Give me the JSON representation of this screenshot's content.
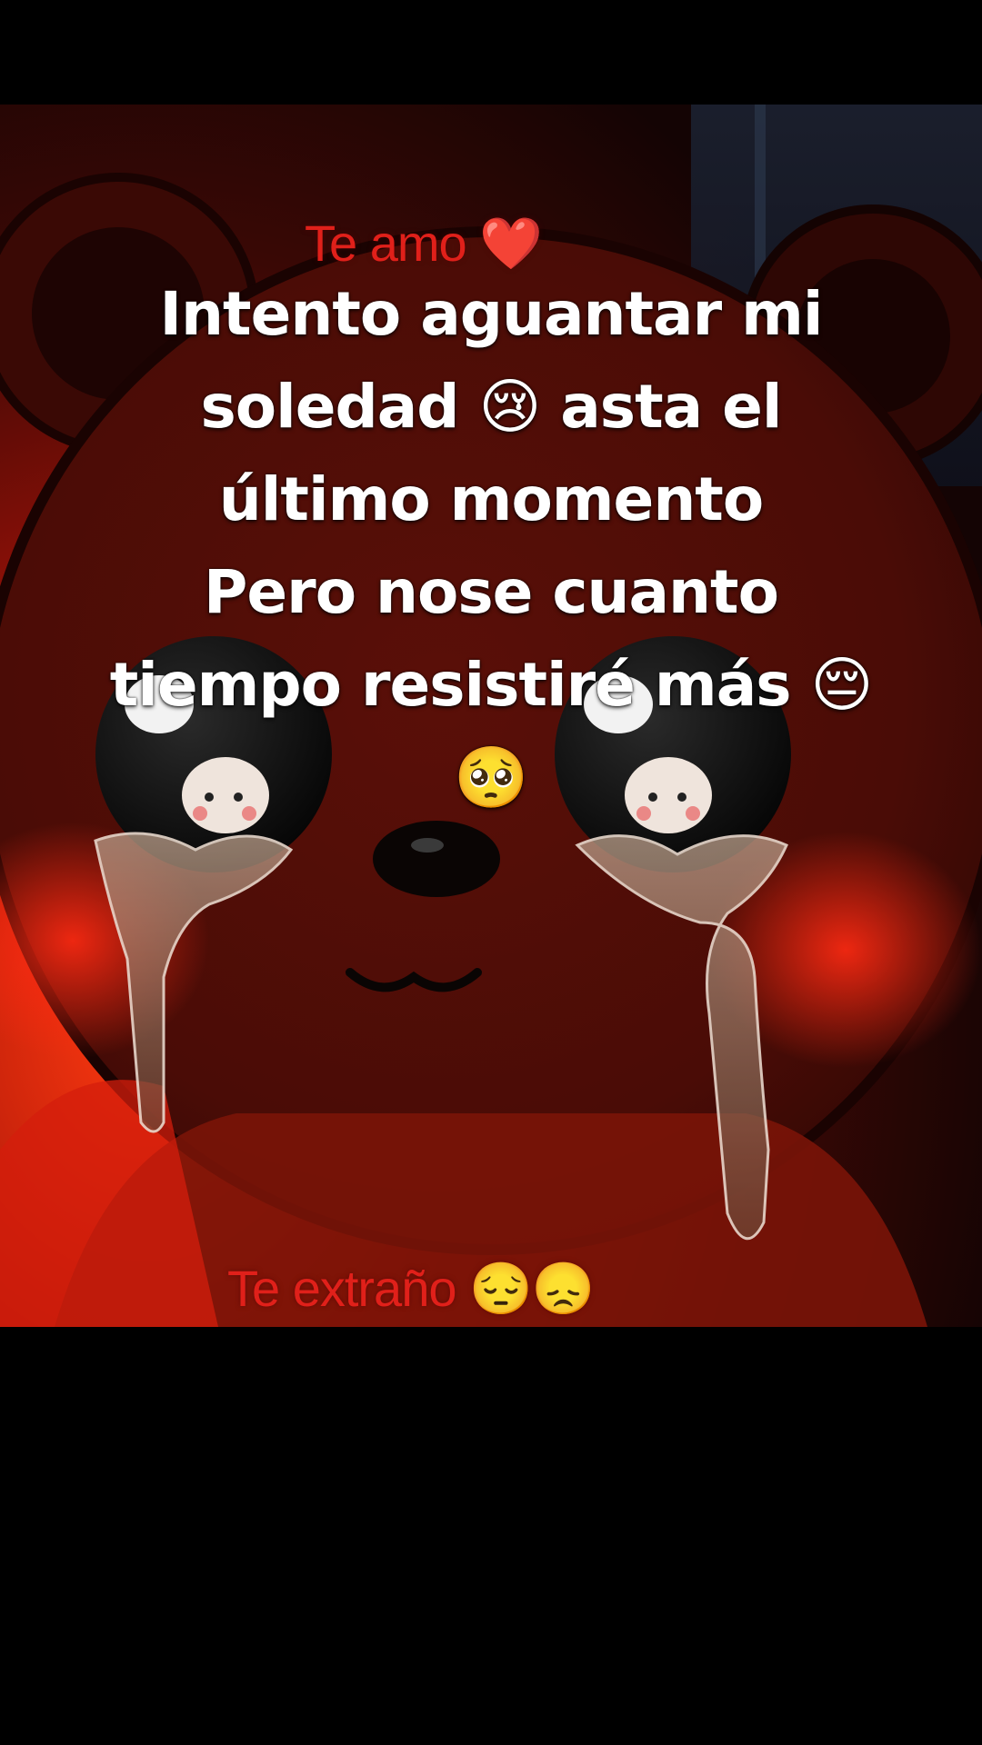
{
  "overlay": {
    "caption": "Intento aguantar mi\nsoledad 😢 asta el\núltimo momento\nPero nose cuanto\ntiempo resistiré más 😔\n🥺"
  },
  "video": {
    "top_text": "Te amo ❤️",
    "bottom_text": "Te extraño 😔😞"
  },
  "colors": {
    "background": "#000000",
    "bear_red": "#6b1208",
    "bear_glow": "#e8200c",
    "embedded_text": "#e0201a",
    "caption_text": "#ffffff"
  }
}
